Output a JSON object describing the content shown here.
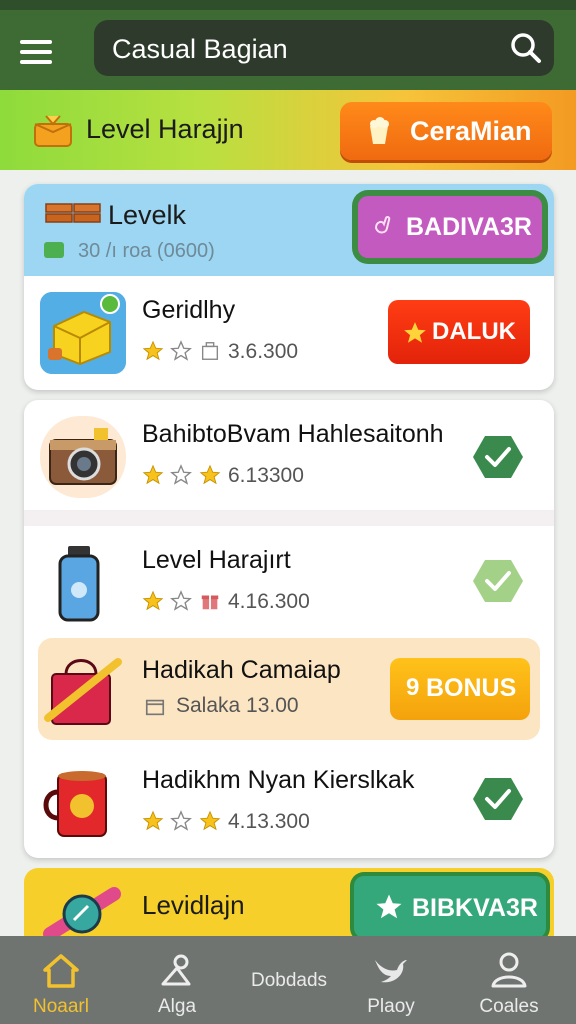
{
  "header": {
    "search_text": "Casual Bagian",
    "menu_icon": "menu-icon",
    "search_icon": "search-icon"
  },
  "banner": {
    "title": "Level Harajjn",
    "button_label": "CeraMian",
    "icon": "gift-box-icon",
    "button_icon": "popcorn-icon"
  },
  "featured": {
    "header_title": "Levelk",
    "header_subtitle": "30 /ı roa (0600)",
    "header_button": "BADIVA3R",
    "item": {
      "title": "Geridlhy",
      "meta": "3.6.300",
      "button_label": "DALUK"
    }
  },
  "list": [
    {
      "title": "BahibtoBvam Hahlesaitonh",
      "meta": "6.13300",
      "action": "check"
    },
    {
      "title": "Level Harajırt",
      "meta": "4.16.300",
      "action": "check"
    },
    {
      "title": "Hadikah Camaiap",
      "meta": "Salaka 13.00",
      "action": "bonus",
      "button_label": "BONUS",
      "button_prefix": "9"
    },
    {
      "title": "Hadikhm Nyan Kierslkak",
      "meta": "4.13.300",
      "action": "check"
    }
  ],
  "bottom_card": {
    "title": "Levidlajn",
    "button_label": "BIBKVA3R"
  },
  "nav": [
    {
      "label": "Noaarl",
      "icon": "home-icon",
      "active": true
    },
    {
      "label": "Alga",
      "icon": "pin-icon",
      "active": false
    },
    {
      "label": "Dobdads",
      "icon": "",
      "active": false
    },
    {
      "label": "Plaoy",
      "icon": "bird-icon",
      "active": false
    },
    {
      "label": "Coales",
      "icon": "profile-icon",
      "active": false
    }
  ],
  "colors": {
    "topbar": "#3e6b33",
    "accent_orange": "#f06a10",
    "check_green": "#3a8a4e",
    "nav_active": "#f2c12e"
  }
}
